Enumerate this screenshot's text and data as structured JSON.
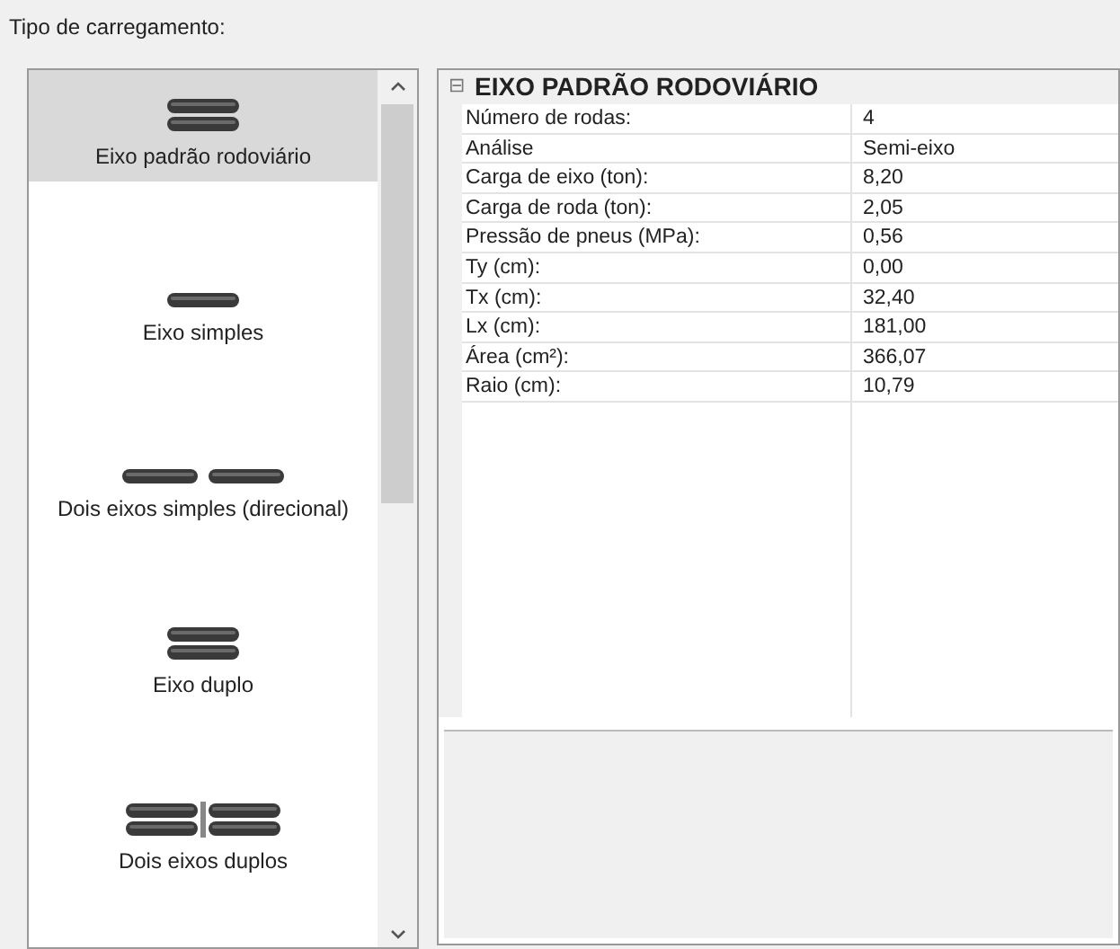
{
  "label": "Tipo de carregamento:",
  "load_types": [
    {
      "kind": "double",
      "label": "Eixo padrão rodoviário",
      "selected": true
    },
    {
      "kind": "single",
      "label": "Eixo simples",
      "selected": false
    },
    {
      "kind": "two-single",
      "label": "Dois eixos simples (direcional)",
      "selected": false
    },
    {
      "kind": "double",
      "label": "Eixo duplo",
      "selected": false
    },
    {
      "kind": "two-double",
      "label": "Dois eixos duplos",
      "selected": false
    }
  ],
  "properties": {
    "category": {
      "title": "EIXO PADRÃO RODOVIÁRIO",
      "expanded": true,
      "toggle": "⊟"
    },
    "rows": [
      {
        "name": "Número de rodas:",
        "value": "4"
      },
      {
        "name": "Análise",
        "value": "Semi-eixo"
      },
      {
        "name": "Carga de eixo (ton):",
        "value": "8,20"
      },
      {
        "name": "Carga de roda (ton):",
        "value": "2,05"
      },
      {
        "name": "Pressão de pneus (MPa):",
        "value": "0,56"
      },
      {
        "name": "Ty (cm):",
        "value": "0,00"
      },
      {
        "name": "Tx (cm):",
        "value": "32,40"
      },
      {
        "name": "Lx (cm):",
        "value": "181,00"
      },
      {
        "name": "Área (cm²):",
        "value": "366,07"
      },
      {
        "name": "Raio (cm):",
        "value": "10,79"
      }
    ]
  }
}
